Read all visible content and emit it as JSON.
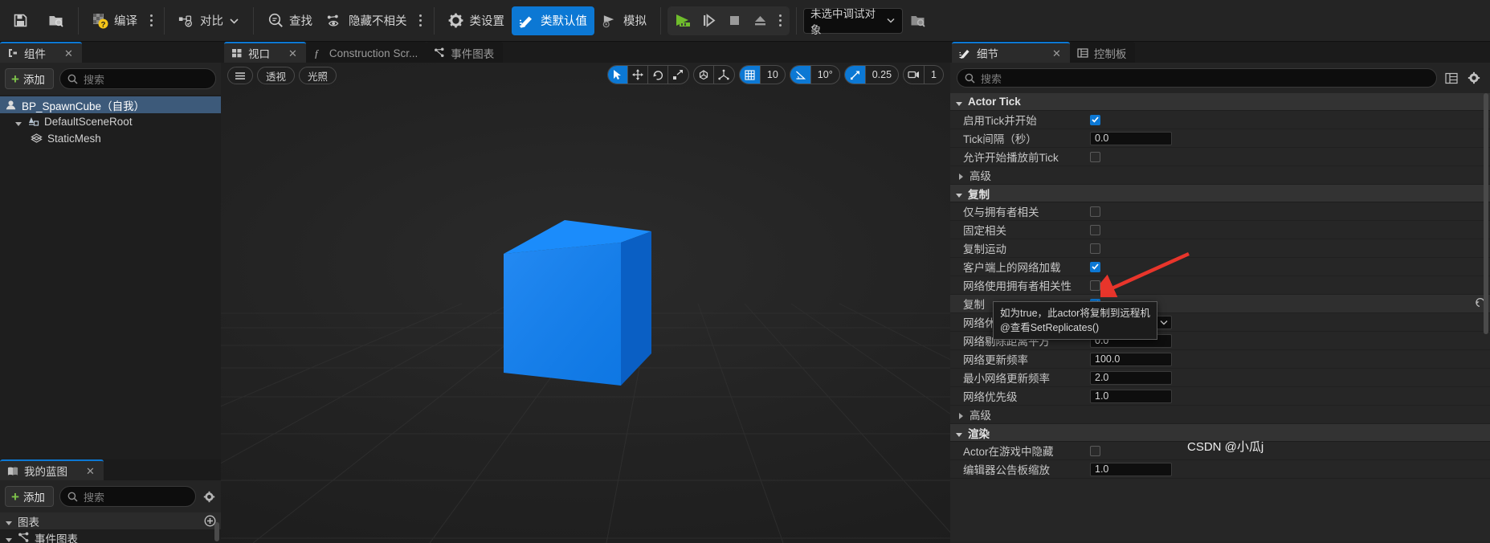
{
  "toolbar": {
    "save_label": "",
    "browse_label": "",
    "compile_label": "编译",
    "diff_label": "对比",
    "find_label": "查找",
    "hide_unrelated_label": "隐藏不相关",
    "class_settings_label": "类设置",
    "class_defaults_label": "类默认值",
    "simulate_label": "模拟",
    "debug_object_value": "未选中调试对象"
  },
  "components_panel": {
    "tab_label": "组件",
    "add_label": "添加",
    "search_placeholder": "搜索",
    "tree": [
      {
        "label": "BP_SpawnCube（自我）",
        "depth": 0,
        "selected": true,
        "icon": "actor-icon",
        "expander": "none"
      },
      {
        "label": "DefaultSceneRoot",
        "depth": 1,
        "selected": false,
        "icon": "scene-root-icon",
        "expander": "expanded"
      },
      {
        "label": "StaticMesh",
        "depth": 2,
        "selected": false,
        "icon": "static-mesh-icon",
        "expander": "none"
      }
    ]
  },
  "my_blueprint_panel": {
    "tab_label": "我的蓝图",
    "add_label": "添加",
    "search_placeholder": "搜索",
    "sections": [
      {
        "label": "图表",
        "expanded": true
      },
      {
        "label": "事件图表",
        "expanded": true
      }
    ]
  },
  "editor_tabs": [
    {
      "label": "视口",
      "active": true,
      "icon": "viewport-icon",
      "closable": true
    },
    {
      "label": "Construction Scr...",
      "active": false,
      "icon": "function-icon",
      "closable": false
    },
    {
      "label": "事件图表",
      "active": false,
      "icon": "graph-icon",
      "closable": false
    }
  ],
  "viewport": {
    "menu_label": "",
    "perspective_label": "透视",
    "lit_label": "光照",
    "grid_snap_value": "10",
    "angle_snap_value": "10°",
    "scale_snap_value": "0.25",
    "camera_speed_value": "1",
    "transform_tools": [
      "select-icon",
      "move-icon",
      "rotate-icon",
      "scale-icon"
    ],
    "space_tools": [
      "world-space-icon",
      "coordinate-icon"
    ]
  },
  "details_panel": {
    "tab_label": "细节",
    "secondary_tab_label": "控制板",
    "search_placeholder": "搜索",
    "categories": [
      {
        "name": "Actor Tick",
        "expanded": true,
        "properties": [
          {
            "label": "启用Tick并开始",
            "type": "checkbox",
            "checked": true
          },
          {
            "label": "Tick间隔（秒）",
            "type": "number",
            "value": "0.0"
          },
          {
            "label": "允许开始播放前Tick",
            "type": "checkbox",
            "checked": false
          },
          {
            "label": "高级",
            "type": "subcategory",
            "expanded": false
          }
        ]
      },
      {
        "name": "复制",
        "expanded": true,
        "properties": [
          {
            "label": "仅与拥有者相关",
            "type": "checkbox",
            "checked": false
          },
          {
            "label": "固定相关",
            "type": "checkbox",
            "checked": false
          },
          {
            "label": "复制运动",
            "type": "checkbox",
            "checked": false
          },
          {
            "label": "客户端上的网络加载",
            "type": "checkbox",
            "checked": true
          },
          {
            "label": "网络使用拥有者相关性",
            "type": "checkbox",
            "checked": false
          },
          {
            "label": "复制",
            "type": "checkbox",
            "checked": true,
            "modified": true
          },
          {
            "label": "网络休眠物理",
            "type": "dropdown",
            "value": ""
          },
          {
            "label": "网络剔除距离平方",
            "type": "number",
            "value": "0.0"
          },
          {
            "label": "网络更新频率",
            "type": "number",
            "value": "100.0"
          },
          {
            "label": "最小网络更新频率",
            "type": "number",
            "value": "2.0"
          },
          {
            "label": "网络优先级",
            "type": "number",
            "value": "1.0"
          },
          {
            "label": "高级",
            "type": "subcategory",
            "expanded": false
          }
        ]
      },
      {
        "name": "渲染",
        "expanded": true,
        "properties": [
          {
            "label": "Actor在游戏中隐藏",
            "type": "checkbox",
            "checked": false
          },
          {
            "label": "编辑器公告板缩放",
            "type": "number",
            "value": "1.0"
          }
        ]
      }
    ]
  },
  "tooltip": {
    "line1": "如为true，此actor将复制到远程机",
    "line2": "@查看SetReplicates()"
  },
  "watermark": "CSDN @小瓜j",
  "colors": {
    "accent": "#0c78d4",
    "cube": "#0a7cf0",
    "panel_bg": "#242424",
    "viewport_bg": "#1f1f1f",
    "annotation_arrow": "#e8352b"
  }
}
